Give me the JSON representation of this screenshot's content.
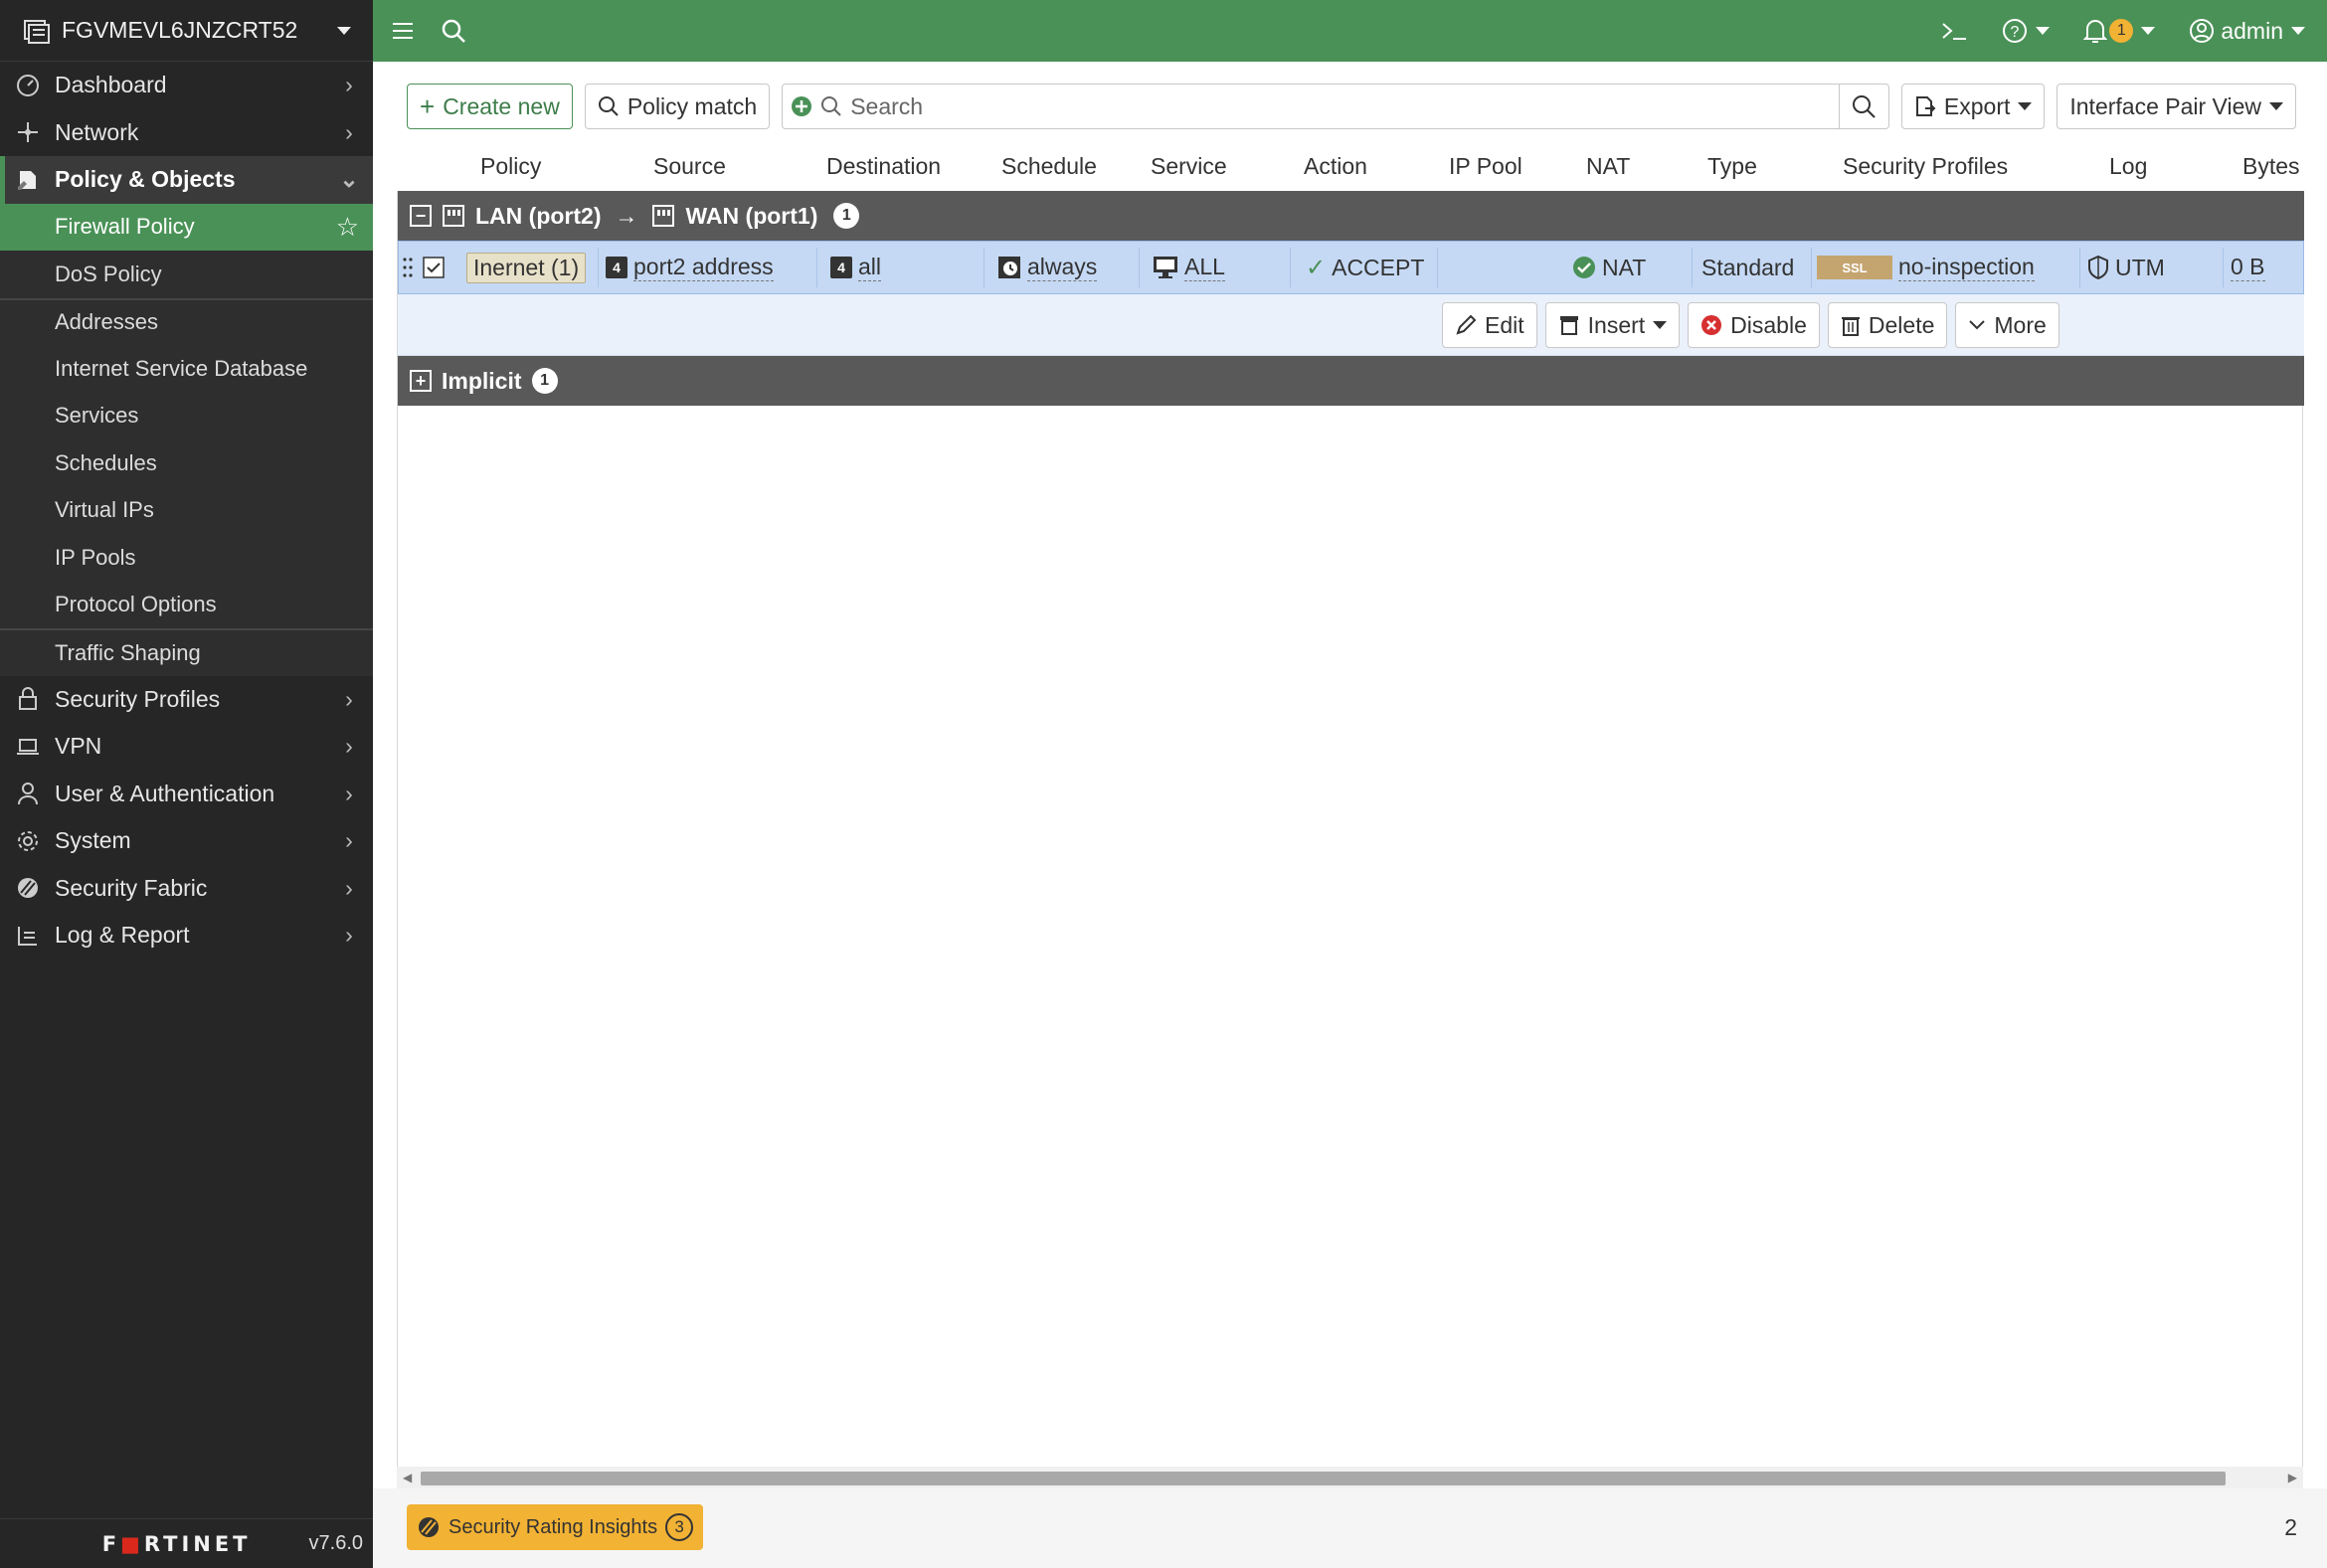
{
  "sidebar": {
    "device_name": "FGVMEVL6JNZCRT52",
    "items": [
      {
        "label": "Dashboard",
        "icon": "dashboard-icon"
      },
      {
        "label": "Network",
        "icon": "network-icon"
      },
      {
        "label": "Policy & Objects",
        "icon": "policy-icon"
      },
      {
        "label": "Security Profiles",
        "icon": "lock-icon"
      },
      {
        "label": "VPN",
        "icon": "laptop-icon"
      },
      {
        "label": "User & Authentication",
        "icon": "user-icon"
      },
      {
        "label": "System",
        "icon": "gear-icon"
      },
      {
        "label": "Security Fabric",
        "icon": "fabric-icon"
      },
      {
        "label": "Log & Report",
        "icon": "log-icon"
      }
    ],
    "policy_sub_items": [
      "Firewall Policy",
      "DoS Policy",
      "Addresses",
      "Internet Service Database",
      "Services",
      "Schedules",
      "Virtual IPs",
      "IP Pools",
      "Protocol Options",
      "Traffic Shaping"
    ],
    "logo_text": "FORTINET",
    "version": "v7.6.0"
  },
  "topbar": {
    "notification_count": "1",
    "user": "admin"
  },
  "toolbar": {
    "create_new": "Create new",
    "policy_match": "Policy match",
    "search_placeholder": "Search",
    "export": "Export",
    "view": "Interface Pair View"
  },
  "table": {
    "columns": [
      "Policy",
      "Source",
      "Destination",
      "Schedule",
      "Service",
      "Action",
      "IP Pool",
      "NAT",
      "Type",
      "Security Profiles",
      "Log",
      "Bytes"
    ],
    "groups": [
      {
        "from": "LAN (port2)",
        "arrow": "→",
        "to": "WAN (port1)",
        "count": "1"
      },
      {
        "label": "Implicit",
        "count": "1"
      }
    ],
    "row": {
      "policy": "Inernet (1)",
      "source": "port2 address",
      "destination": "all",
      "schedule": "always",
      "service": "ALL",
      "action": "ACCEPT",
      "ip_pool": "",
      "nat": "NAT",
      "type": "Standard",
      "ssl_badge": "SSL",
      "security_profile": "no-inspection",
      "log": "UTM",
      "bytes": "0 B"
    },
    "row_actions": {
      "edit": "Edit",
      "insert": "Insert",
      "disable": "Disable",
      "delete": "Delete",
      "more": "More"
    }
  },
  "footer": {
    "insights_label": "Security Rating Insights",
    "insights_count": "3",
    "page_count": "2"
  },
  "colors": {
    "accent": "#4a9157",
    "sidebar_bg": "#262626",
    "selected_row": "#c5d9f4",
    "group_header": "#595959",
    "insights": "#f2b234"
  }
}
